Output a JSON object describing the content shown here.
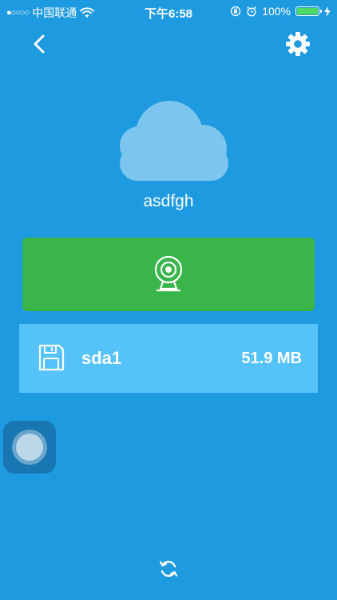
{
  "status_bar": {
    "signal": "●○○○○",
    "carrier": "中国联通",
    "time": "下午6:58",
    "battery_percent": "100%",
    "battery_level": 1.0
  },
  "header": {
    "back_icon": "chevron-left-icon",
    "settings_icon": "gear-icon"
  },
  "device": {
    "icon": "cloud-icon",
    "name": "asdfgh"
  },
  "camera_button": {
    "icon": "webcam-icon",
    "color": "#3ab54a"
  },
  "storage": {
    "icon": "floppy-disk-icon",
    "name": "sda1",
    "size": "51.9 MB",
    "color": "#56c2fa"
  },
  "footer": {
    "refresh_icon": "refresh-icon"
  },
  "colors": {
    "background": "#1e9be0",
    "battery_fill": "#4cd964"
  }
}
